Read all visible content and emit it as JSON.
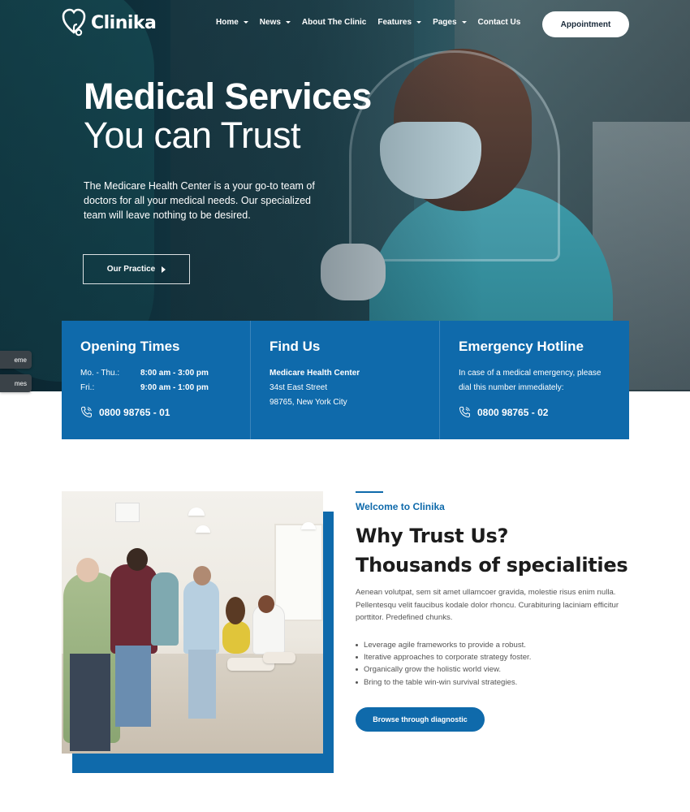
{
  "brand": {
    "name": "Clinika"
  },
  "nav": {
    "items": [
      {
        "label": "Home",
        "dropdown": true
      },
      {
        "label": "News",
        "dropdown": true
      },
      {
        "label": "About The Clinic",
        "dropdown": false
      },
      {
        "label": "Features",
        "dropdown": true
      },
      {
        "label": "Pages",
        "dropdown": true
      },
      {
        "label": "Contact Us",
        "dropdown": false
      }
    ],
    "cta": "Appointment"
  },
  "hero": {
    "title": "Medical Services",
    "subtitle": "You can Trust",
    "description": "The Medicare Health Center is a your go-to team of doctors for all your medical needs. Our specialized team will leave nothing to be desired.",
    "button": "Our Practice"
  },
  "side_tabs": [
    "eme",
    "mes"
  ],
  "info": {
    "opening": {
      "title": "Opening Times",
      "rows": [
        {
          "day": "Mo. - Thu.:",
          "time": "8:00 am - 3:00 pm"
        },
        {
          "day": "Fri.:",
          "time": "9:00 am - 1:00 pm"
        }
      ],
      "phone": "0800 98765 - 01"
    },
    "find": {
      "title": "Find Us",
      "name": "Medicare Health Center",
      "street": "34st East Street",
      "city": "98765, New York City"
    },
    "emergency": {
      "title": "Emergency Hotline",
      "line1": "In case of a medical emergency, please",
      "line2": "dial this number immediately:",
      "phone": "0800 98765 - 02"
    }
  },
  "about": {
    "eyebrow": "Welcome to Clinika",
    "title_line1": "Why Trust Us?",
    "title_line2": "Thousands of specialities",
    "description": "Aenean volutpat, sem sit amet ullamcoer gravida, molestie risus enim nulla. Pellentesqu velit faucibus kodale dolor rhoncu. Curabituring laciniam efficitur porttitor. Predefined chunks.",
    "bullets": [
      "Leverage agile frameworks to provide a robust.",
      "Iterative approaches to corporate strategy foster.",
      "Organically grow the holistic world view.",
      "Bring to the table win-win survival strategies."
    ],
    "button": "Browse through diagnostic"
  },
  "colors": {
    "primary": "#0f6aab",
    "hero_dark": "#14414e",
    "text_dark": "#1c1c1c"
  }
}
